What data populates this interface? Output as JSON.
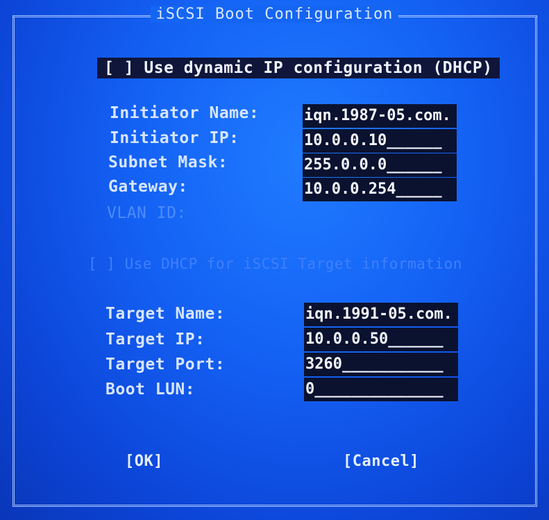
{
  "dialog": {
    "title": "iSCSI Boot Configuration",
    "dhcp_checkbox": "[ ] Use dynamic IP configuration (DHCP)",
    "target_dhcp_checkbox": "[ ] Use DHCP for iSCSI Target information",
    "initiator": {
      "name_label": "Initiator Name:",
      "name_value": "iqn.1987-05.com.",
      "ip_label": "Initiator IP:",
      "ip_value": "10.0.0.10______",
      "mask_label": "Subnet Mask:",
      "mask_value": "255.0.0.0______",
      "gateway_label": "Gateway:",
      "gateway_value": "10.0.0.254_____",
      "vlan_label": "VLAN ID:"
    },
    "target": {
      "name_label": "Target Name:",
      "name_value": "iqn.1991-05.com.",
      "ip_label": "Target IP:",
      "ip_value": "10.0.0.50______",
      "port_label": "Target Port:",
      "port_value": "3260___________",
      "lun_label": "Boot LUN:",
      "lun_value": "0______________"
    },
    "ok_button": "[OK]",
    "cancel_button": "[Cancel]"
  },
  "colors": {
    "background": "#1461f4",
    "field": "#0b1230",
    "text": "#d7e5ff",
    "disabled": "#4d8cff"
  }
}
